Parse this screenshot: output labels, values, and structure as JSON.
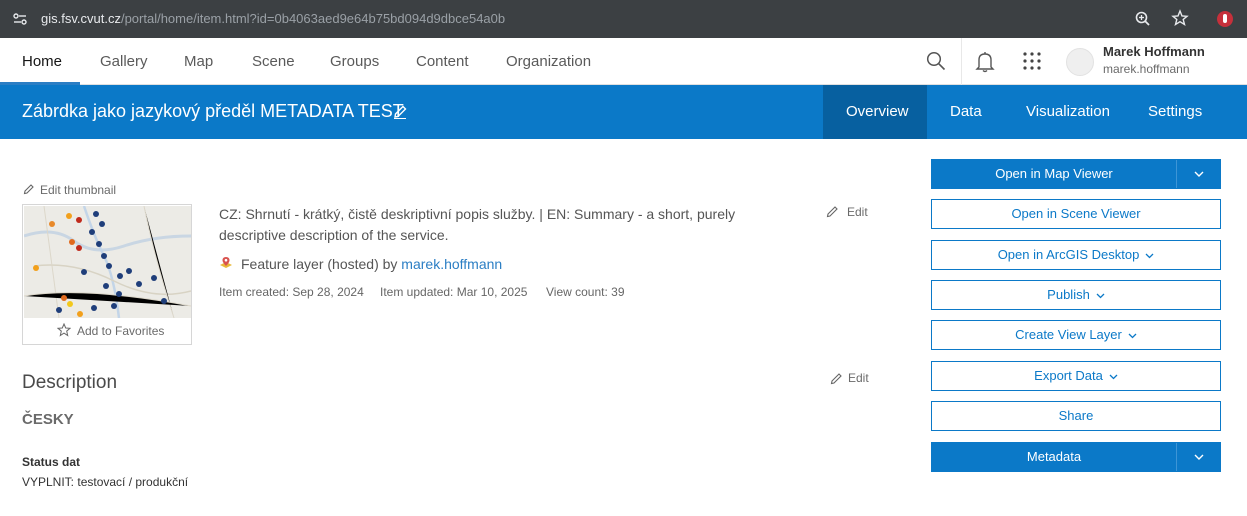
{
  "browser": {
    "url_host": "gis.fsv.cvut.cz",
    "url_path": "/portal/home/item.html?id=0b4063aed9e64b75bd094d9dbce54a0b",
    "site_icon": "site-settings-icon",
    "zoom_icon": "zoom-icon",
    "bookmark_icon": "star-icon",
    "extension_icon": "extension-icon"
  },
  "nav": {
    "items": [
      "Home",
      "Gallery",
      "Map",
      "Scene",
      "Groups",
      "Content",
      "Organization"
    ],
    "active": "Home",
    "accent": "#2b7ec4"
  },
  "user": {
    "name": "Marek Hoffmann",
    "login": "marek.hoffmann"
  },
  "item": {
    "title": "Zábrdka jako jazykový předěl METADATA TEST",
    "tabs": [
      "Overview",
      "Data",
      "Visualization",
      "Settings"
    ],
    "active_tab": "Overview",
    "brand_color": "#0b79c8"
  },
  "thumbnail": {
    "edit_label": "Edit thumbnail",
    "favorite_label": "Add to Favorites"
  },
  "summary": {
    "text": "CZ: Shrnutí - krátký, čistě deskriptivní popis služby. | EN: Summary - a short, purely descriptive description of the service.",
    "edit_label": "Edit"
  },
  "layer": {
    "type_prefix": "Feature layer (hosted) by ",
    "owner": "marek.hoffmann"
  },
  "meta": {
    "created": "Item created: Sep 28, 2024",
    "updated": "Item updated: Mar 10, 2025",
    "views": "View count: 39"
  },
  "description": {
    "heading": "Description",
    "edit_label": "Edit",
    "language_heading": "ČESKY",
    "status_label": "Status dat",
    "status_value": "VYPLNIT: testovací / produkční"
  },
  "actions": {
    "open_map_viewer": "Open in Map Viewer",
    "open_scene_viewer": "Open in Scene Viewer",
    "open_arcgis_desktop": "Open in ArcGIS Desktop",
    "publish": "Publish",
    "create_view_layer": "Create View Layer",
    "export_data": "Export Data",
    "share": "Share",
    "metadata": "Metadata"
  }
}
